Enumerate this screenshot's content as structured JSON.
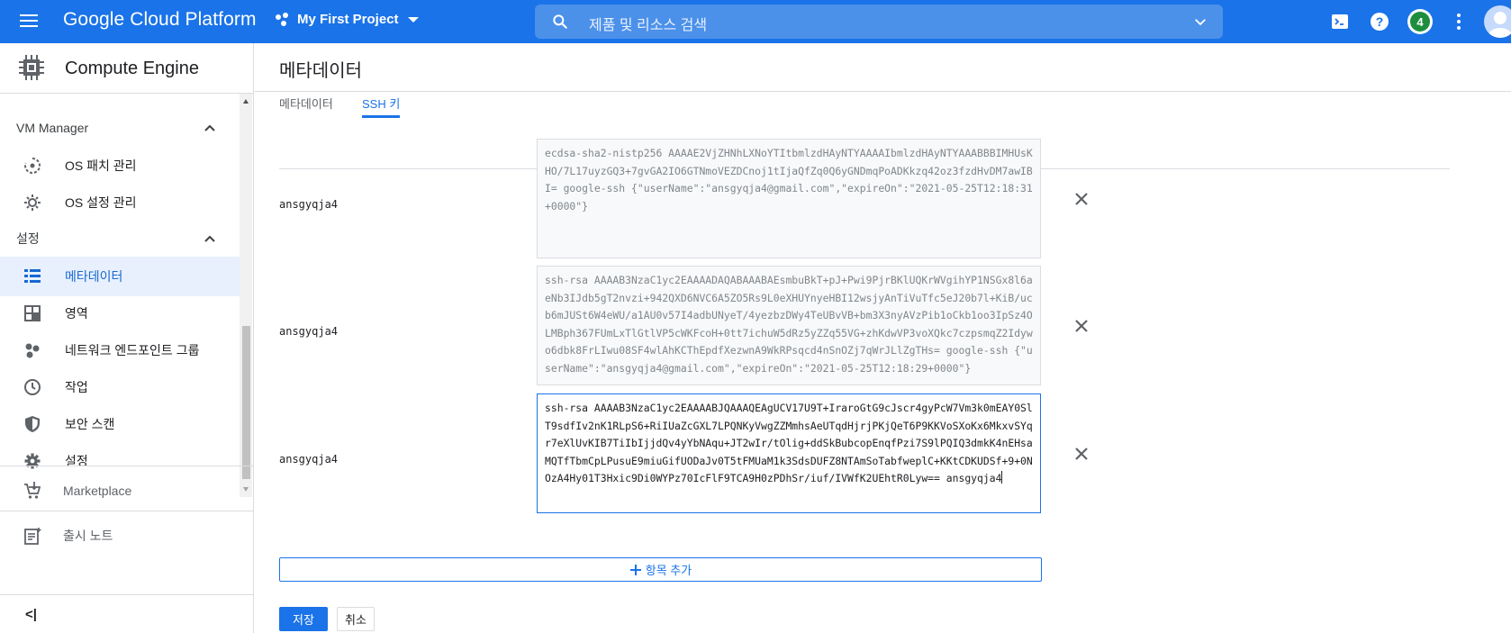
{
  "topbar": {
    "brand": "Google Cloud Platform",
    "project": "My First Project",
    "search_placeholder": "제품 및 리소스 검색",
    "notification_count": "4",
    "accent_color": "#1a73e8",
    "icons": [
      "menu-icon",
      "search-icon",
      "chevron-down-icon",
      "cloud-shell-icon",
      "help-icon",
      "more-vert-icon",
      "account-avatar"
    ]
  },
  "sidebar": {
    "product_title": "Compute Engine",
    "sections": [
      {
        "label": "VM Manager",
        "items": [
          {
            "label": "OS 패치 관리",
            "icon": "patch-icon"
          },
          {
            "label": "OS 설정 관리",
            "icon": "os-config-icon"
          }
        ]
      },
      {
        "label": "설정",
        "items": [
          {
            "label": "메타데이터",
            "icon": "metadata-icon",
            "active": true
          },
          {
            "label": "영역",
            "icon": "zones-icon"
          },
          {
            "label": "네트워크 엔드포인트 그룹",
            "icon": "network-endpoint-icon"
          },
          {
            "label": "작업",
            "icon": "operations-icon"
          },
          {
            "label": "보안 스캔",
            "icon": "security-scan-icon"
          },
          {
            "label": "설정",
            "icon": "settings-icon"
          }
        ]
      }
    ],
    "marketplace": "Marketplace",
    "release_notes": "출시 노트",
    "collapse_label": "<|"
  },
  "main": {
    "page_title": "메타데이터",
    "tabs": [
      {
        "label": "메타데이터",
        "active": false
      },
      {
        "label": "SSH 키",
        "active": true
      }
    ],
    "ssh_keys": [
      {
        "user": "ansgyqja4",
        "value": "ecdsa-sha2-nistp256 AAAAE2VjZHNhLXNoYTItbmlzdHAyNTYAAAAIbmlzdHAyNTYAAABBBIMHUsKHO/7L17uyzGQ3+7gvGA2IO6GTNmoVEZDCnoj1tIjaQfZq0Q6yGNDmqPoADKkzq42oz3fzdHvDM7awIBI= google-ssh {\"userName\":\"ansgyqja4@gmail.com\",\"expireOn\":\"2021-05-25T12:18:31+0000\"}",
        "editing": false
      },
      {
        "user": "ansgyqja4",
        "value": "ssh-rsa AAAAB3NzaC1yc2EAAAADAQABAAABAEsmbuBkT+pJ+Pwi9PjrBKlUQKrWVgihYP1NSGx8l6aeNb3IJdb5gT2nvzi+942QXD6NVC6A5ZO5Rs9L0eXHUYnyeHBI12wsjyAnTiVuTfc5eJ20b7l+KiB/ucb6mJUSt6W4eWU/a1AU0v57I4adbUNyeT/4yezbzDWy4TeUBvVB+bm3X3nyAVzPib1oCkb1oo3IpSz4OLMBph367FUmLxTlGtlVP5cWKFcoH+0tt7ichuW5dRz5yZZq55VG+zhKdwVP3voXQkc7czpsmqZ2Idywo6dbk8FrLIwu08SF4wlAhKCThEpdfXezwnA9WkRPsqcd4nSnOZj7qWrJLlZgTHs= google-ssh {\"userName\":\"ansgyqja4@gmail.com\",\"expireOn\":\"2021-05-25T12:18:29+0000\"}",
        "editing": false
      },
      {
        "user": "ansgyqja4",
        "value": "ssh-rsa AAAAB3NzaC1yc2EAAAABJQAAAQEAgUCV17U9T+IraroGtG9cJscr4gyPcW7Vm3k0mEAY0SlT9sdfIv2nK1RLpS6+RiIUaZcGXL7LPQNKyVwgZZMmhsAeUTqdHjrjPKjQeT6P9KKVoSXoKx6MkxvSYqr7eXlUvKIB7TiIbIjjdQv4yYbNAqu+JT2wIr/tOlig+ddSkBubcopEnqfPzi7S9lPQIQ3dmkK4nEHsaMQTfTbmCpLPusuE9miuGifUODaJv0T5tFMUaM1k3SdsDUFZ8NTAmSoTabfweplC+KKtCDKUDSf+9+0NOzA4Hy01T3Hxic9Di0WYPz70IcFlF9TCA9H0zPDhSr/iuf/IVWfK2UEhtR0Lyw== ansgyqja4",
        "editing": true
      }
    ],
    "add_item_label": "항목 추가",
    "save_label": "저장",
    "cancel_label": "취소"
  }
}
